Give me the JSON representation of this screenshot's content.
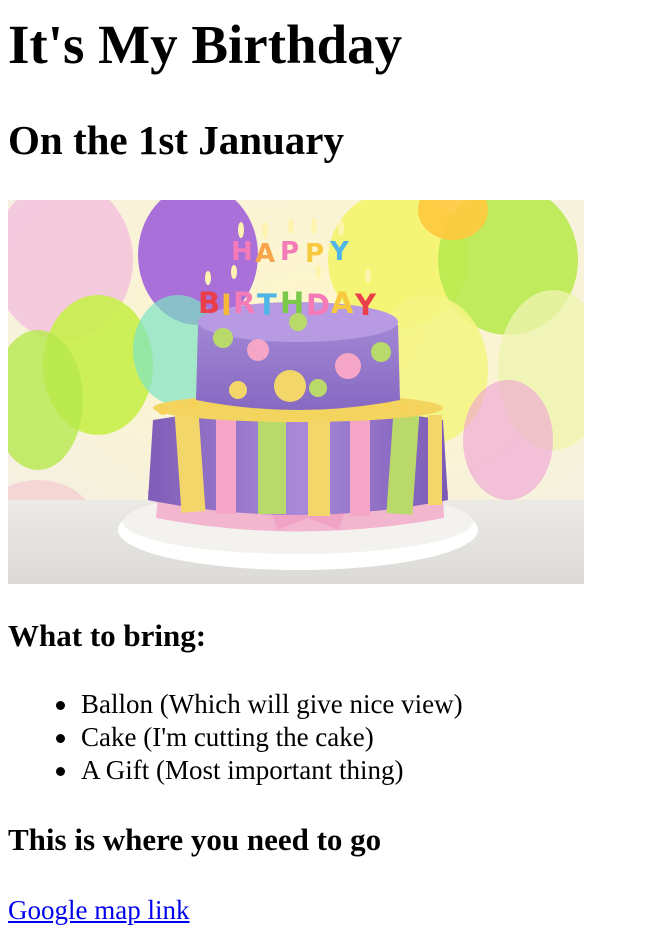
{
  "title": "It's My Birthday",
  "subtitle": "On the 1st January",
  "image": {
    "subject": "birthday-cake-photo",
    "candles_top": "HAPPY",
    "candles_bottom": "BIRTHDAY"
  },
  "bring": {
    "heading": "What to bring:",
    "items": [
      "Ballon (Which will give nice view)",
      "Cake (I'm cutting the cake)",
      "A Gift (Most important thing)"
    ]
  },
  "directions": {
    "heading": "This is where you need to go",
    "link_text": "Google map link"
  },
  "colors": {
    "link": "#0000ee",
    "text": "#000000"
  }
}
